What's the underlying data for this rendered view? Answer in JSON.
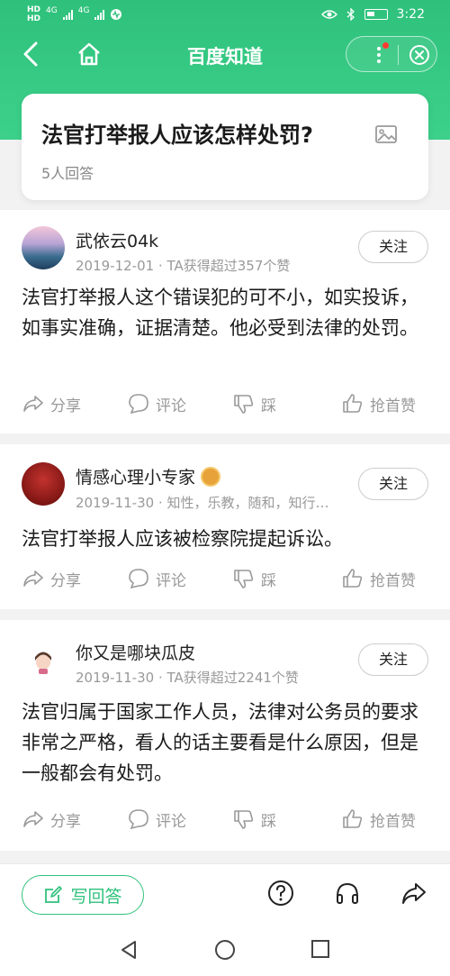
{
  "status_bar": {
    "left_labels": [
      "HD",
      "HD"
    ],
    "network": [
      "4G",
      "4G"
    ],
    "time": "3:22"
  },
  "nav": {
    "title": "百度知道",
    "icons": [
      "back-arrow-icon",
      "home-icon",
      "more-icon",
      "close-icon"
    ],
    "notification_dot_color": "#ff3b30"
  },
  "question": {
    "title": "法官打举报人应该怎样处罚?",
    "answer_count": "5人回答"
  },
  "answers": [
    {
      "author": "武依云04k",
      "meta": "2019-12-01 · TA获得超过357个赞",
      "follow_label": "关注",
      "body": "法官打举报人这个错误犯的可不小，如实投诉，如事实准确，证据清楚。他必受到法律的处罚。",
      "actions": [
        "分享",
        "评论",
        "踩",
        "抢首赞"
      ]
    },
    {
      "author": "情感心理小专家",
      "meta": "2019-11-30 · 知性，乐教，随和，知行…",
      "follow_label": "关注",
      "body": "法官打举报人应该被检察院提起诉讼。",
      "actions": [
        "分享",
        "评论",
        "踩",
        "抢首赞"
      ]
    },
    {
      "author": "你又是哪块瓜皮",
      "meta": "2019-11-30 · TA获得超过2241个赞",
      "follow_label": "关注",
      "body": "法官归属于国家工作人员，法律对公务员的要求非常之严格，看人的话主要看是什么原因，但是一般都会有处罚。",
      "actions": [
        "分享",
        "评论",
        "踩",
        "抢首赞"
      ]
    }
  ],
  "bottom_bar": {
    "write_label": "写回答",
    "icons": [
      "help-icon",
      "headphones-icon",
      "share-icon"
    ]
  },
  "colors": {
    "brand_green": "#2fc17c",
    "muted_text": "#999999"
  }
}
